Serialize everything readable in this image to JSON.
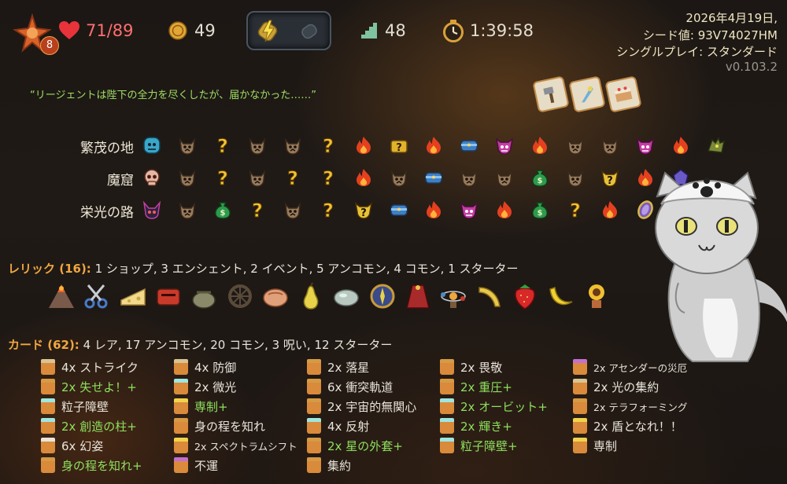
{
  "top": {
    "ascension_level": "8",
    "hp": "71/89",
    "gold": "49",
    "floor": "48",
    "time": "1:39:58"
  },
  "meta": {
    "date": "2026年4月19日,",
    "seed": "シード値: 93V74027HM",
    "mode": "シングルプレイ: スタンダード",
    "version": "v0.103.2"
  },
  "quote": "“リージェントは陛下の全力を尽くしたが、届かなかった……”",
  "acts": [
    {
      "name": "繁茂の地",
      "nodes": [
        "boss-blue",
        "monster",
        "unknown",
        "monster",
        "monster",
        "unknown",
        "fire",
        "treasure-unknown",
        "fire",
        "shop",
        "elite",
        "fire",
        "monster",
        "monster",
        "elite",
        "fire",
        "boss-dragon"
      ]
    },
    {
      "name": "魔窟",
      "nodes": [
        "boss-skull",
        "monster",
        "unknown",
        "monster",
        "unknown",
        "unknown",
        "fire",
        "monster",
        "shop",
        "monster",
        "monster",
        "merchant",
        "monster",
        "elite-unknown",
        "fire",
        "elite-gem"
      ]
    },
    {
      "name": "栄光の路",
      "nodes": [
        "boss-horn",
        "monster",
        "merchant",
        "unknown",
        "monster",
        "unknown",
        "elite-unknown",
        "shop",
        "fire",
        "elite",
        "fire",
        "merchant",
        "unknown",
        "fire",
        "boss-mirror"
      ]
    }
  ],
  "relics": {
    "header_label": "レリック (16):",
    "summary": " 1 ショップ, 3 エンシェント, 2 イベント, 5 アンコモン, 4 コモン, 1 スターター",
    "icons": [
      "volcano-relic",
      "scissors-relic",
      "cheese-relic",
      "mailbox-relic",
      "pouch-relic",
      "wheel-relic",
      "bread-relic",
      "pear-relic",
      "stone-relic",
      "compass-relic",
      "cloak-relic",
      "orrery-relic",
      "horn-relic",
      "strawberry-relic",
      "banana-relic",
      "sunflower-relic"
    ]
  },
  "cards": {
    "header_label": "カード (62):",
    "summary": " 4 レア, 17 アンコモン, 20 コモン, 3 呪い, 12 スターター",
    "columns": [
      [
        {
          "text": "4x ストライク",
          "style": "normal",
          "color": "#d8c392"
        },
        {
          "text": "2x 失せよ！+",
          "style": "up",
          "color": "#d69a45"
        },
        {
          "text": "粒子障壁",
          "style": "normal",
          "color": "#9ee6e0"
        },
        {
          "text": "2x 創造の柱+",
          "style": "up",
          "color": "#9ee6e0"
        },
        {
          "text": "6x 幻姿",
          "style": "normal",
          "color": "#e8e4da"
        },
        {
          "text": "身の程を知れ+",
          "style": "up",
          "color": "#d69a45"
        }
      ],
      [
        {
          "text": "4x 防御",
          "style": "normal",
          "color": "#d8c392"
        },
        {
          "text": "2x 微光",
          "style": "normal",
          "color": "#9ee6e0"
        },
        {
          "text": "専制+",
          "style": "up",
          "color": "#f1d24b"
        },
        {
          "text": "身の程を知れ",
          "style": "normal",
          "color": "#d69a45"
        },
        {
          "text": "2x スペクトラムシフト",
          "style": "small",
          "color": "#f1d24b"
        },
        {
          "text": "不運",
          "style": "normal",
          "color": "#c36fd1"
        }
      ],
      [
        {
          "text": "2x 落星",
          "style": "normal",
          "color": "#d69a45"
        },
        {
          "text": "6x 衝突軌道",
          "style": "normal",
          "color": "#d69a45"
        },
        {
          "text": "2x 宇宙的無関心",
          "style": "normal",
          "color": "#d69a45"
        },
        {
          "text": "4x 反射",
          "style": "normal",
          "color": "#9ee6e0"
        },
        {
          "text": "2x 星の外套+",
          "style": "up",
          "color": "#d69a45"
        },
        {
          "text": "集約",
          "style": "normal",
          "color": "#d69a45"
        }
      ],
      [
        {
          "text": "2x 畏敬",
          "style": "normal",
          "color": "#d69a45"
        },
        {
          "text": "2x 重圧+",
          "style": "up",
          "color": "#d69a45"
        },
        {
          "text": "2x オービット+",
          "style": "up",
          "color": "#9ee6e0"
        },
        {
          "text": "2x 輝き+",
          "style": "up",
          "color": "#9ee6e0"
        },
        {
          "text": "粒子障壁+",
          "style": "up",
          "color": "#9ee6e0"
        }
      ],
      [
        {
          "text": "2x アセンダーの災厄",
          "style": "small",
          "color": "#c36fd1"
        },
        {
          "text": "2x 光の集約",
          "style": "normal",
          "color": "#d8c392"
        },
        {
          "text": "2x テラフォーミング",
          "style": "small",
          "color": "#d69a45"
        },
        {
          "text": "2x 盾となれ！！",
          "style": "normal",
          "color": "#f1d24b"
        },
        {
          "text": "専制",
          "style": "normal",
          "color": "#f1d24b"
        }
      ]
    ]
  },
  "colors": {
    "accent_orange": "#f0a640",
    "upgraded_green": "#8de05e",
    "hp_red": "#ff6f6f",
    "quote_green": "#9fe063"
  }
}
